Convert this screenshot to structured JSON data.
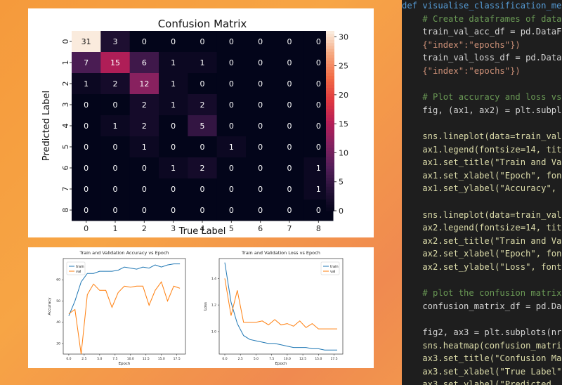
{
  "chart_data": [
    {
      "type": "heatmap",
      "title": "Confusion Matrix",
      "xlabel": "True Label",
      "ylabel": "Predicted Label",
      "x_categories": [
        "0",
        "1",
        "2",
        "3",
        "4",
        "5",
        "6",
        "7",
        "8"
      ],
      "y_categories": [
        "0",
        "1",
        "2",
        "3",
        "4",
        "5",
        "6",
        "7",
        "8"
      ],
      "values": [
        [
          31,
          3,
          0,
          0,
          0,
          0,
          0,
          0,
          0
        ],
        [
          7,
          15,
          6,
          1,
          1,
          0,
          0,
          0,
          0
        ],
        [
          1,
          2,
          12,
          1,
          0,
          0,
          0,
          0,
          0
        ],
        [
          0,
          0,
          2,
          1,
          2,
          0,
          0,
          0,
          0
        ],
        [
          0,
          1,
          2,
          0,
          5,
          0,
          0,
          0,
          0
        ],
        [
          0,
          0,
          1,
          0,
          0,
          1,
          0,
          0,
          0
        ],
        [
          0,
          0,
          0,
          1,
          2,
          0,
          0,
          0,
          1
        ],
        [
          0,
          0,
          0,
          0,
          0,
          0,
          0,
          0,
          1
        ],
        [
          0,
          0,
          0,
          0,
          0,
          0,
          0,
          0,
          0
        ]
      ],
      "colorbar_ticks": [
        0,
        5,
        10,
        15,
        20,
        25,
        30
      ],
      "colorbar_range": [
        0,
        31
      ]
    },
    {
      "type": "line",
      "title": "Train and Validation Accuracy vs Epoch",
      "xlabel": "Epoch",
      "ylabel": "Accuracy",
      "xticks": [
        "0.0",
        "2.5",
        "5.0",
        "7.5",
        "10.0",
        "12.5",
        "15.0",
        "17.5"
      ],
      "yticks": [
        "30",
        "40",
        "50",
        "60"
      ],
      "xlim": [
        -0.9,
        18.9
      ],
      "ylim": [
        25,
        70
      ],
      "legend": "top-left",
      "series": [
        {
          "name": "train",
          "color": "#1f77b4",
          "x": [
            0,
            1,
            2,
            3,
            4,
            5,
            6,
            7,
            8,
            9,
            10,
            11,
            12,
            13,
            14,
            15,
            16,
            17,
            18
          ],
          "values": [
            43,
            50,
            59,
            63,
            63,
            64,
            64,
            64,
            64.5,
            66,
            65.5,
            65,
            66,
            65.5,
            67,
            66,
            67,
            67.5,
            67.5
          ]
        },
        {
          "name": "val",
          "color": "#ff7f0e",
          "x": [
            0,
            1,
            2,
            3,
            4,
            5,
            6,
            7,
            8,
            9,
            10,
            11,
            12,
            13,
            14,
            15,
            16,
            17,
            18
          ],
          "values": [
            44,
            46,
            25,
            53,
            58,
            55,
            55,
            47,
            54,
            57,
            56.5,
            57,
            57,
            48,
            55,
            59,
            50,
            57,
            56
          ]
        }
      ]
    },
    {
      "type": "line",
      "title": "Train and Validation Loss vs Epoch",
      "xlabel": "Epoch",
      "ylabel": "Loss",
      "xticks": [
        "0.0",
        "2.5",
        "5.0",
        "7.5",
        "10.0",
        "12.5",
        "15.0",
        "17.5"
      ],
      "yticks": [
        "1.0",
        "1.2",
        "1.4"
      ],
      "xlim": [
        -0.9,
        18.9
      ],
      "ylim": [
        0.83,
        1.55
      ],
      "legend": "top-right",
      "series": [
        {
          "name": "train",
          "color": "#1f77b4",
          "x": [
            0,
            1,
            2,
            3,
            4,
            5,
            6,
            7,
            8,
            9,
            10,
            11,
            12,
            13,
            14,
            15,
            16,
            17,
            18
          ],
          "values": [
            1.52,
            1.22,
            1.06,
            0.97,
            0.94,
            0.93,
            0.92,
            0.91,
            0.91,
            0.9,
            0.89,
            0.88,
            0.88,
            0.88,
            0.87,
            0.87,
            0.86,
            0.86,
            0.86
          ]
        },
        {
          "name": "val",
          "color": "#ff7f0e",
          "x": [
            0,
            1,
            2,
            3,
            4,
            5,
            6,
            7,
            8,
            9,
            10,
            11,
            12,
            13,
            14,
            15,
            16,
            17,
            18
          ],
          "values": [
            1.4,
            1.12,
            1.31,
            1.07,
            1.07,
            1.07,
            1.08,
            1.05,
            1.09,
            1.05,
            1.06,
            1.04,
            1.08,
            1.03,
            1.06,
            1.02,
            1.02,
            1.02,
            1.02
          ]
        }
      ]
    }
  ],
  "code": {
    "lines": [
      {
        "c": "#569cd6",
        "t": "def visualise_classification_me"
      },
      {
        "c": "#6a9955",
        "t": "    # Create dataframes of data"
      },
      {
        "c": "#d4d4d4",
        "t": "    train_val_acc_df = pd.DataF"
      },
      {
        "c": "#ce9178",
        "t": "    {\"index\":\"epochs\"})"
      },
      {
        "c": "#d4d4d4",
        "t": "    train_val_loss_df = pd.Data"
      },
      {
        "c": "#ce9178",
        "t": "    {\"index\":\"epochs\"})"
      },
      {
        "c": "#d4d4d4",
        "t": ""
      },
      {
        "c": "#6a9955",
        "t": "    # Plot accuracy and loss vs"
      },
      {
        "c": "#d4d4d4",
        "t": "    fig, (ax1, ax2) = plt.subpl"
      },
      {
        "c": "#d4d4d4",
        "t": ""
      },
      {
        "c": "#dcdcaa",
        "t": "    sns.lineplot(data=train_val"
      },
      {
        "c": "#dcdcaa",
        "t": "    ax1.legend(fontsize=14, tit"
      },
      {
        "c": "#dcdcaa",
        "t": "    ax1.set_title(\"Train and Va"
      },
      {
        "c": "#dcdcaa",
        "t": "    ax1.set_xlabel(\"Epoch\", fon"
      },
      {
        "c": "#dcdcaa",
        "t": "    ax1.set_ylabel(\"Accuracy\","
      },
      {
        "c": "#d4d4d4",
        "t": ""
      },
      {
        "c": "#dcdcaa",
        "t": "    sns.lineplot(data=train_val"
      },
      {
        "c": "#dcdcaa",
        "t": "    ax2.legend(fontsize=14, tit"
      },
      {
        "c": "#dcdcaa",
        "t": "    ax2.set_title(\"Train and Va"
      },
      {
        "c": "#dcdcaa",
        "t": "    ax2.set_xlabel(\"Epoch\", fon"
      },
      {
        "c": "#dcdcaa",
        "t": "    ax2.set_ylabel(\"Loss\", font"
      },
      {
        "c": "#d4d4d4",
        "t": ""
      },
      {
        "c": "#6a9955",
        "t": "    # plot the confusion matrix"
      },
      {
        "c": "#d4d4d4",
        "t": "    confusion_matrix_df = pd.Da"
      },
      {
        "c": "#d4d4d4",
        "t": ""
      },
      {
        "c": "#d4d4d4",
        "t": "    fig2, ax3 = plt.subplots(nr"
      },
      {
        "c": "#dcdcaa",
        "t": "    sns.heatmap(confusion_matri"
      },
      {
        "c": "#dcdcaa",
        "t": "    ax3.set_title(\"Confusion Ma"
      },
      {
        "c": "#dcdcaa",
        "t": "    ax3.set_xlabel(\"True Label\""
      },
      {
        "c": "#dcdcaa",
        "t": "    ax3.set_ylabel(\"Predicted "
      }
    ]
  }
}
